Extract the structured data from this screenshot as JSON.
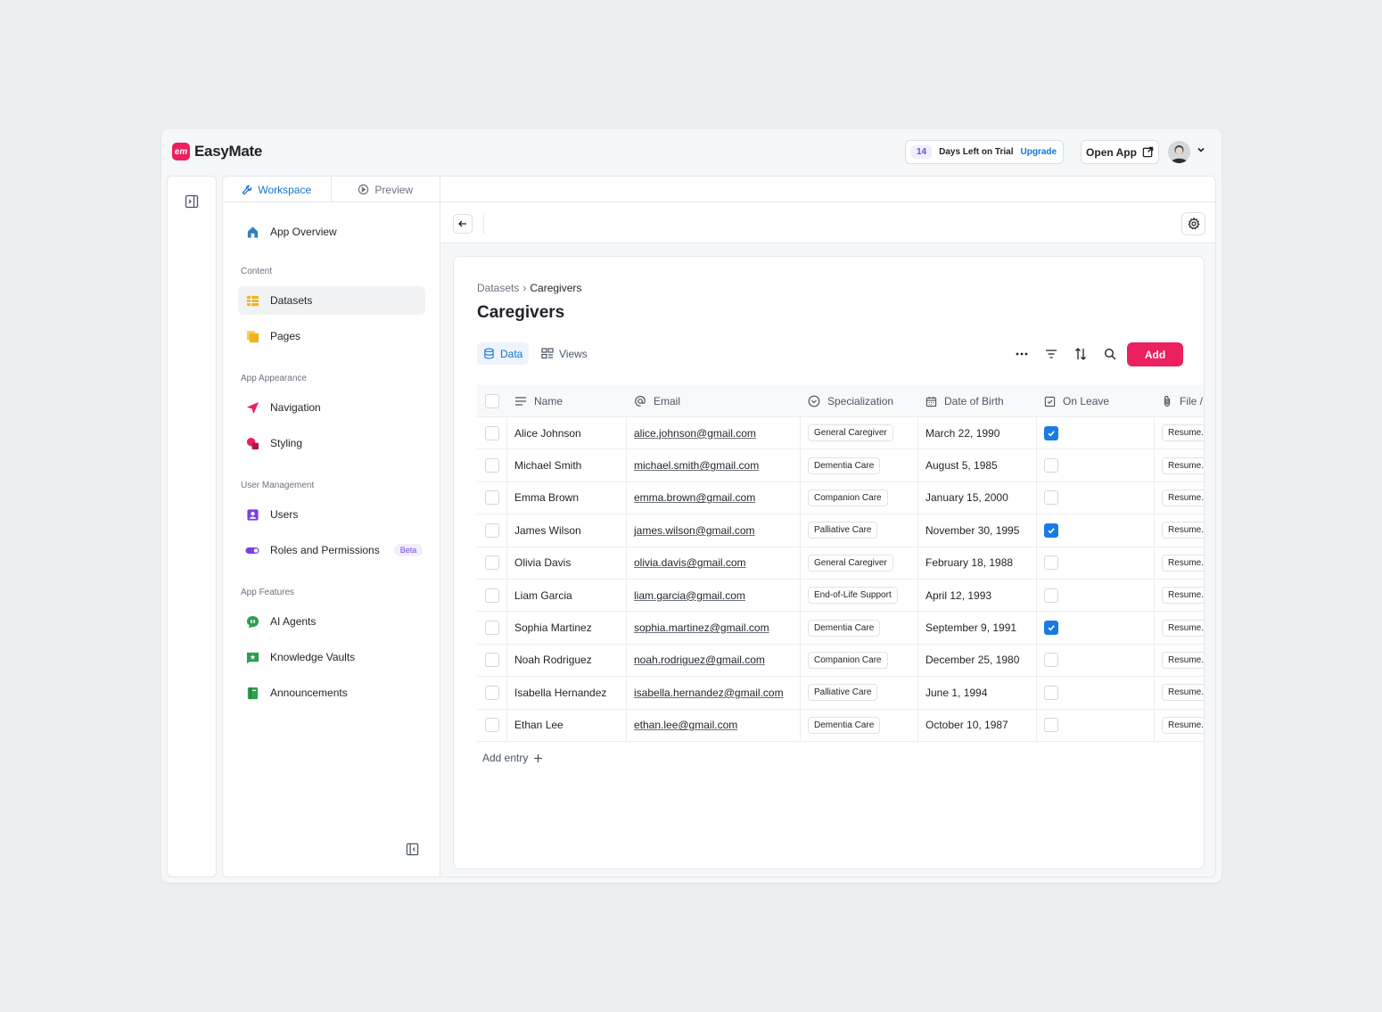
{
  "app": {
    "name": "EasyMate",
    "logo_text": "em"
  },
  "header": {
    "trial_days": "14",
    "trial_text": "Days Left on Trial",
    "upgrade_label": "Upgrade",
    "open_app_label": "Open App"
  },
  "sidebar": {
    "tabs": [
      {
        "label": "Workspace",
        "active": true
      },
      {
        "label": "Preview",
        "active": false
      }
    ],
    "overview": {
      "label": "App Overview"
    },
    "sections": {
      "content": "Content",
      "appearance": "App Appearance",
      "users": "User Management",
      "features": "App Features"
    },
    "items": {
      "datasets": "Datasets",
      "pages": "Pages",
      "navigation": "Navigation",
      "styling": "Styling",
      "users": "Users",
      "roles": "Roles and Permissions",
      "roles_badge": "Beta",
      "ai_agents": "AI Agents",
      "knowledge_vaults": "Knowledge Vaults",
      "announcements": "Announcements"
    }
  },
  "main": {
    "breadcrumb": {
      "parent": "Datasets",
      "separator": "›",
      "current": "Caregivers"
    },
    "title": "Caregivers",
    "view_tabs": {
      "data": "Data",
      "views": "Views"
    },
    "add_label": "Add",
    "add_entry_label": "Add entry",
    "columns": {
      "name": "Name",
      "email": "Email",
      "specialization": "Specialization",
      "dob": "Date of Birth",
      "on_leave": "On Leave",
      "file": "File /"
    },
    "rows": [
      {
        "name": "Alice Johnson",
        "email": "alice.johnson@gmail.com",
        "specialization": "General Caregiver",
        "dob": "March 22, 1990",
        "on_leave": true,
        "file": "Resume.p"
      },
      {
        "name": "Michael Smith",
        "email": "michael.smith@gmail.com",
        "specialization": "Dementia Care",
        "dob": "August 5, 1985",
        "on_leave": false,
        "file": "Resume.p"
      },
      {
        "name": "Emma Brown",
        "email": "emma.brown@gmail.com",
        "specialization": "Companion Care",
        "dob": "January 15, 2000",
        "on_leave": false,
        "file": "Resume.p"
      },
      {
        "name": "James Wilson",
        "email": "james.wilson@gmail.com",
        "specialization": "Palliative Care",
        "dob": "November 30, 1995",
        "on_leave": true,
        "file": "Resume.p"
      },
      {
        "name": "Olivia Davis",
        "email": "olivia.davis@gmail.com",
        "specialization": "General Caregiver",
        "dob": "February 18, 1988",
        "on_leave": false,
        "file": "Resume.p"
      },
      {
        "name": "Liam Garcia",
        "email": "liam.garcia@gmail.com",
        "specialization": "End-of-Life Support",
        "dob": "April 12, 1993",
        "on_leave": false,
        "file": "Resume.p"
      },
      {
        "name": "Sophia Martinez",
        "email": "sophia.martinez@gmail.com",
        "specialization": "Dementia Care",
        "dob": "September 9, 1991",
        "on_leave": true,
        "file": "Resume.p"
      },
      {
        "name": "Noah Rodriguez",
        "email": "noah.rodriguez@gmail.com",
        "specialization": "Companion Care",
        "dob": "December 25, 1980",
        "on_leave": false,
        "file": "Resume.p"
      },
      {
        "name": "Isabella Hernandez",
        "email": "isabella.hernandez@gmail.com",
        "specialization": "Palliative Care",
        "dob": "June 1, 1994",
        "on_leave": false,
        "file": "Resume.p"
      },
      {
        "name": "Ethan Lee",
        "email": "ethan.lee@gmail.com",
        "specialization": "Dementia Care",
        "dob": "October 10, 1987",
        "on_leave": false,
        "file": "Resume.p"
      }
    ]
  },
  "colors": {
    "accent": "#ec1f5f",
    "link": "#1573d6",
    "checkbox_on": "#1a7be6",
    "beta": "#6c4bd6"
  },
  "icons": {
    "rail_toggle": "sidebar-expand-icon",
    "workspace": "wrench-icon",
    "preview": "play-circle-icon",
    "overview": "home-icon",
    "datasets": "table-icon",
    "pages": "pages-icon",
    "navigation": "send-icon",
    "styling": "shapes-icon",
    "users": "user-card-icon",
    "roles": "toggle-icon",
    "ai_agents": "ai-agent-icon",
    "knowledge_vaults": "vault-icon",
    "announcements": "book-icon",
    "back": "arrow-left-icon",
    "settings": "gear-icon"
  }
}
